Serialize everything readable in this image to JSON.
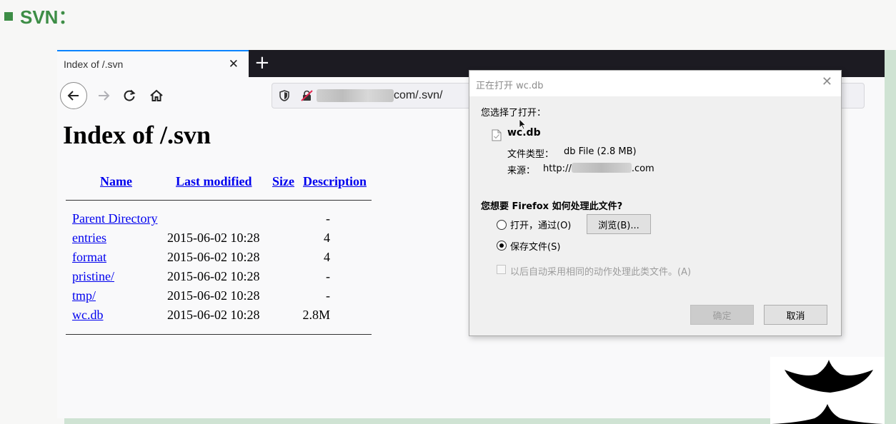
{
  "slide": {
    "title": "SVN："
  },
  "browser": {
    "tab_title": "Index of /.svn",
    "tab_close": "✕",
    "new_tab": "+",
    "url_visible": "com/.svn/"
  },
  "listing": {
    "heading": "Index of /.svn",
    "columns": {
      "name": "Name",
      "modified": "Last modified",
      "size": "Size",
      "description": "Description"
    },
    "rows": [
      {
        "name": "Parent Directory",
        "modified": "",
        "size": "-"
      },
      {
        "name": "entries",
        "modified": "2015-06-02 10:28",
        "size": "4"
      },
      {
        "name": "format",
        "modified": "2015-06-02 10:28",
        "size": "4"
      },
      {
        "name": "pristine/",
        "modified": "2015-06-02 10:28",
        "size": "-"
      },
      {
        "name": "tmp/",
        "modified": "2015-06-02 10:28",
        "size": "-"
      },
      {
        "name": "wc.db",
        "modified": "2015-06-02 10:28",
        "size": "2.8M"
      }
    ]
  },
  "dialog": {
    "title": "正在打开 wc.db",
    "close": "✕",
    "chosen_label": "您选择了打开：",
    "file_name": "wc.db",
    "file_type_label": "文件类型：",
    "file_type_value": "db File (2.8 MB)",
    "source_label": "来源：",
    "source_prefix": "http://",
    "source_suffix": ".com",
    "question": "您想要 Firefox 如何处理此文件?",
    "open_with_label": "打开，通过(O)",
    "browse_button": "浏览(B)...",
    "save_file_label": "保存文件(S)",
    "save_selected": true,
    "auto_label": "以后自动采用相同的动作处理此类文件。(A)",
    "ok_button": "确定",
    "cancel_button": "取消"
  }
}
